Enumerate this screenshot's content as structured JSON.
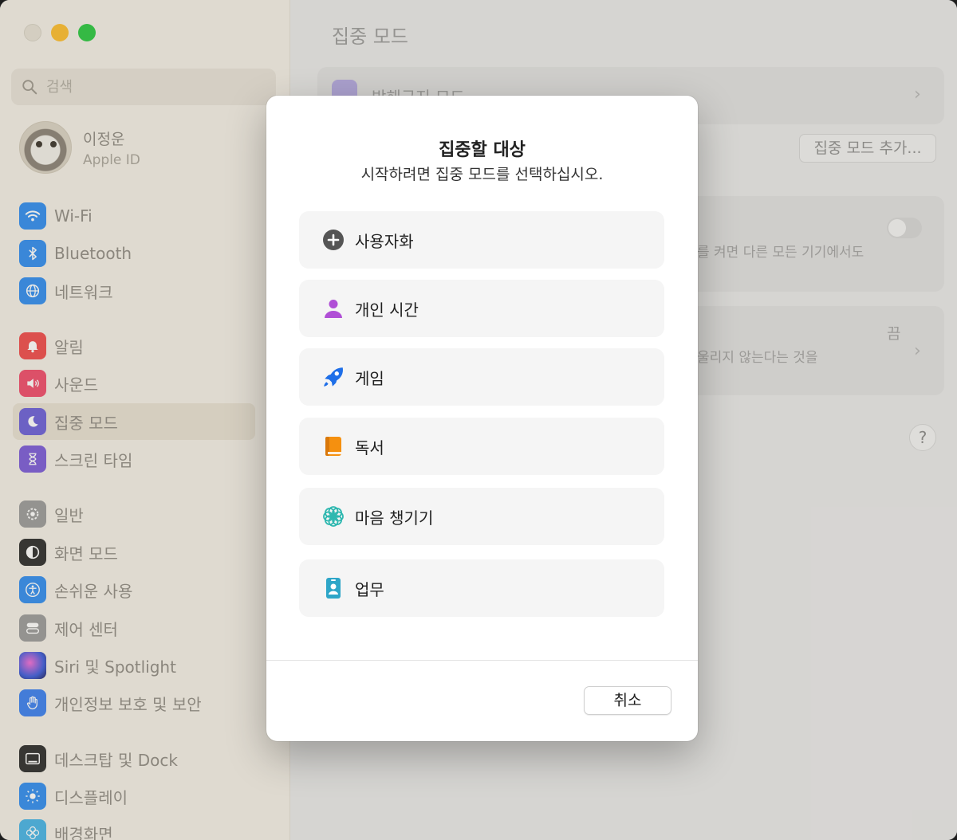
{
  "sidebar": {
    "search_placeholder": "검색",
    "account": {
      "name": "이정운",
      "sub": "Apple ID"
    },
    "items": [
      {
        "label": "Wi-Fi",
        "icon": "wifi-icon",
        "color": "#2f8cf0"
      },
      {
        "label": "Bluetooth",
        "icon": "bluetooth-icon",
        "color": "#2f8cf0"
      },
      {
        "label": "네트워크",
        "icon": "globe-icon",
        "color": "#2f8cf0"
      },
      {
        "label": "알림",
        "icon": "bell-icon",
        "color": "#f04b4b"
      },
      {
        "label": "사운드",
        "icon": "speaker-icon",
        "color": "#f04b6b"
      },
      {
        "label": "집중 모드",
        "icon": "moon-icon",
        "color": "#6b5fd8",
        "active": true
      },
      {
        "label": "스크린 타임",
        "icon": "hourglass-icon",
        "color": "#7a5ad8"
      },
      {
        "label": "일반",
        "icon": "gear-icon",
        "color": "#9a9a9a"
      },
      {
        "label": "화면 모드",
        "icon": "appearance-icon",
        "color": "#2b2b2b"
      },
      {
        "label": "손쉬운 사용",
        "icon": "accessibility-icon",
        "color": "#2f8cf0"
      },
      {
        "label": "제어 센터",
        "icon": "control-center-icon",
        "color": "#9a9a9a"
      },
      {
        "label": "Siri 및 Spotlight",
        "icon": "siri-icon",
        "color": "#3b5bdc"
      },
      {
        "label": "개인정보 보호 및 보안",
        "icon": "hand-icon",
        "color": "#3a7ff0"
      },
      {
        "label": "데스크탑 및 Dock",
        "icon": "dock-icon",
        "color": "#2b2b2b"
      },
      {
        "label": "디스플레이",
        "icon": "sun-icon",
        "color": "#2f8cf0"
      },
      {
        "label": "배경화면",
        "icon": "flower-icon",
        "color": "#46b3e6"
      }
    ]
  },
  "main": {
    "title": "집중 모드",
    "row1_label": "방해금지 모드",
    "add_button": "집중 모드 추가...",
    "share_text": "를 켜면 다른 모든 기기에서도",
    "status_value": "끔",
    "status_text": "울리지 않는다는 것을",
    "help": "?"
  },
  "modal": {
    "title": "집중할 대상",
    "subtitle": "시작하려면 집중 모드를 선택하십시오.",
    "options": [
      {
        "label": "사용자화",
        "icon": "plus-circle-icon",
        "color": "#555555"
      },
      {
        "label": "개인 시간",
        "icon": "person-icon",
        "color": "#b04fd6"
      },
      {
        "label": "게임",
        "icon": "rocket-icon",
        "color": "#1f6fe8"
      },
      {
        "label": "독서",
        "icon": "book-icon",
        "color": "#f5900f"
      },
      {
        "label": "마음 챙기기",
        "icon": "flower-icon",
        "color": "#2fb8b0"
      },
      {
        "label": "업무",
        "icon": "id-badge-icon",
        "color": "#2ea6c8"
      }
    ],
    "cancel": "취소"
  }
}
